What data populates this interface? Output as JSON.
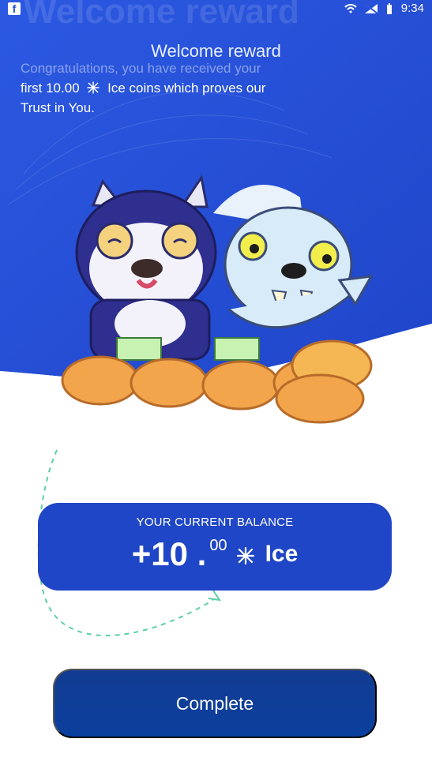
{
  "status_bar": {
    "time": "9:34",
    "left_icon": "facebook-icon"
  },
  "header": {
    "ghost_title": "Welcome reward",
    "title": "Welcome reward",
    "intro_faded": "Congratulations, you have received your",
    "intro_line2": "first 10.00",
    "intro_unit": "Ice coins which proves our",
    "intro_line3": "Trust in You."
  },
  "balance": {
    "label": "YOUR CURRENT BALANCE",
    "value_main": "+10 .",
    "value_decimal": "00",
    "unit": "Ice"
  },
  "action": {
    "complete_label": "Complete"
  },
  "colors": {
    "primary": "#1f46c6",
    "button": "#0b3f9e",
    "hero_bg": "#2a56db"
  },
  "icons": {
    "coin_icon": "snowflake-icon",
    "wifi": "wifi-icon",
    "signal": "signal-icon",
    "battery": "battery-icon"
  }
}
